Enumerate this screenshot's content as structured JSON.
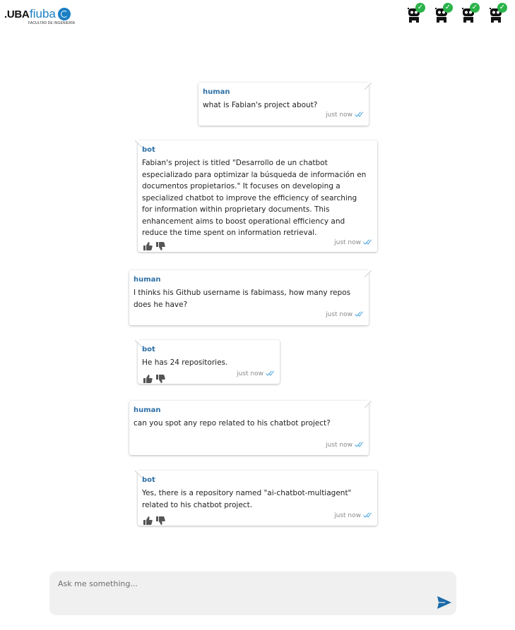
{
  "header": {
    "logo_uba": ".UBA",
    "logo_fiuba": "fiuba",
    "logo_sub": "FACULTAD DE INGENIERÍA",
    "agents": [
      {
        "icon": "robot-icon",
        "status": "check-icon"
      },
      {
        "icon": "robot-icon",
        "status": "check-icon"
      },
      {
        "icon": "robot-icon",
        "status": "check-icon"
      },
      {
        "icon": "robot-icon",
        "status": "check-icon"
      }
    ]
  },
  "messages": [
    {
      "role": "human",
      "sender": "human",
      "text": "what is Fabian's project about?",
      "time": "just now"
    },
    {
      "role": "bot",
      "sender": "bot",
      "text": "Fabian's project is titled \"Desarrollo de un chatbot especializado para optimizar la búsqueda de información en documentos propietarios.\" It focuses on developing a specialized chatbot to improve the efficiency of searching for information within proprietary documents. This enhancement aims to boost operational efficiency and reduce the time spent on information retrieval.",
      "time": "just now"
    },
    {
      "role": "human",
      "sender": "human",
      "text": "I thinks his Github username is fabimass, how many repos does he have?",
      "time": "just now"
    },
    {
      "role": "bot",
      "sender": "bot",
      "text": "He has 24 repositories.",
      "time": "just now"
    },
    {
      "role": "human",
      "sender": "human",
      "text": "can you spot any repo related to his chatbot project?",
      "time": "just now"
    },
    {
      "role": "bot",
      "sender": "bot",
      "text": "Yes, there is a repository named \"ai-chatbot-multiagent\" related to his chatbot project.",
      "time": "just now"
    }
  ],
  "composer": {
    "placeholder": "Ask me something...",
    "send_icon": "send-icon"
  },
  "colors": {
    "sender": "#2d6fa6",
    "accent": "#1b6aa8",
    "read_ticks": "#4aa3df",
    "status_ok": "#2bb34a",
    "composer_bg": "#f0f0f0"
  }
}
